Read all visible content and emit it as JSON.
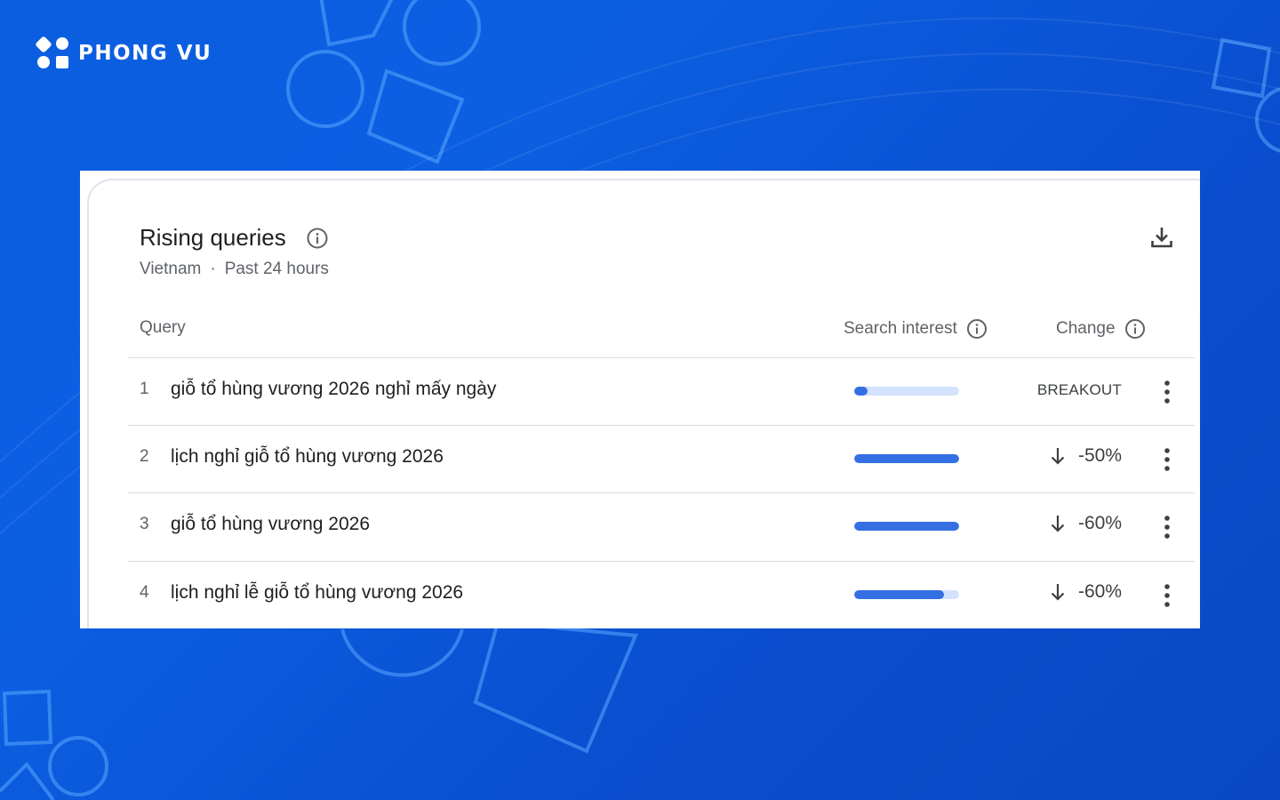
{
  "brand": {
    "name": "PHONG VU",
    "logo_icon": "phong-vu-logo-icon"
  },
  "card": {
    "title": "Rising queries",
    "subtitle": {
      "region": "Vietnam",
      "separator": "·",
      "period": "Past 24 hours"
    },
    "download_icon": "download-icon"
  },
  "columns": {
    "query": "Query",
    "search_interest": "Search interest",
    "change": "Change"
  },
  "rows": [
    {
      "rank": "1",
      "query": "giỗ tổ hùng vương 2026 nghỉ mấy ngày",
      "interest": 0.13,
      "change": "BREAKOUT",
      "direction": "none"
    },
    {
      "rank": "2",
      "query": "lịch nghỉ giỗ tổ hùng vương 2026",
      "interest": 1.0,
      "change": "-50%",
      "direction": "down"
    },
    {
      "rank": "3",
      "query": "giỗ tổ hùng vương 2026",
      "interest": 1.0,
      "change": "-60%",
      "direction": "down"
    },
    {
      "rank": "4",
      "query": "lịch nghỉ lễ giỗ tổ hùng vương 2026",
      "interest": 0.86,
      "change": "-60%",
      "direction": "down"
    }
  ],
  "colors": {
    "background": "#0b5ee0",
    "bar_fill": "#3470e4",
    "bar_track": "#d3e3fd",
    "text_primary": "#1f1f1f",
    "text_secondary": "#5f6368"
  }
}
